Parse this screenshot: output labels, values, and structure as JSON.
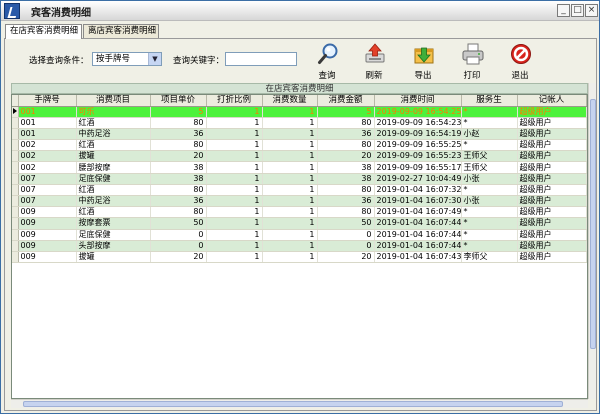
{
  "window": {
    "title": "宾客消费明细",
    "controls": {
      "minimize": "_",
      "maximize": "□",
      "close": "×"
    }
  },
  "tabs": [
    {
      "label": "在店宾客消费明细",
      "active": true
    },
    {
      "label": "离店宾客消费明细",
      "active": false
    }
  ],
  "query": {
    "condition_label": "选择查询条件：",
    "condition_value": "按手牌号",
    "keyword_label": "查询关键字：",
    "keyword_value": ""
  },
  "toolbar": {
    "query": "查询",
    "refresh": "刷新",
    "export": "导出",
    "print": "打印",
    "exit": "退出"
  },
  "grid": {
    "caption": "在店宾客消费明细",
    "columns": [
      "手牌号",
      "消费项目",
      "项目单价",
      "打折比例",
      "消费数量",
      "消费金额",
      "消费时间",
      "服务生",
      "记帐人"
    ],
    "rows": [
      [
        "001",
        "可乐",
        "5",
        "1",
        "1",
        "5",
        "2019-09-09 16:54:25",
        "*",
        "超级用户"
      ],
      [
        "001",
        "红酒",
        "80",
        "1",
        "1",
        "80",
        "2019-09-09 16:54:23",
        "*",
        "超级用户"
      ],
      [
        "001",
        "中药足浴",
        "36",
        "1",
        "1",
        "36",
        "2019-09-09 16:54:19",
        "小赵",
        "超级用户"
      ],
      [
        "002",
        "红酒",
        "80",
        "1",
        "1",
        "80",
        "2019-09-09 16:55:25",
        "*",
        "超级用户"
      ],
      [
        "002",
        "拔罐",
        "20",
        "1",
        "1",
        "20",
        "2019-09-09 16:55:23",
        "王师父",
        "超级用户"
      ],
      [
        "002",
        "腰部按摩",
        "38",
        "1",
        "1",
        "38",
        "2019-09-09 16:55:17",
        "王师父",
        "超级用户"
      ],
      [
        "007",
        "足底保健",
        "38",
        "1",
        "1",
        "38",
        "2019-02-27 10:04:49",
        "小张",
        "超级用户"
      ],
      [
        "007",
        "红酒",
        "80",
        "1",
        "1",
        "80",
        "2019-01-04 16:07:32",
        "*",
        "超级用户"
      ],
      [
        "007",
        "中药足浴",
        "36",
        "1",
        "1",
        "36",
        "2019-01-04 16:07:30",
        "小张",
        "超级用户"
      ],
      [
        "009",
        "红酒",
        "80",
        "1",
        "1",
        "80",
        "2019-01-04 16:07:49",
        "*",
        "超级用户"
      ],
      [
        "009",
        "按摩套票",
        "50",
        "1",
        "1",
        "50",
        "2019-01-04 16:07:44",
        "*",
        "超级用户"
      ],
      [
        "009",
        "足底保健",
        "0",
        "1",
        "1",
        "0",
        "2019-01-04 16:07:44",
        "*",
        "超级用户"
      ],
      [
        "009",
        "头部按摩",
        "0",
        "1",
        "1",
        "0",
        "2019-01-04 16:07:44",
        "*",
        "超级用户"
      ],
      [
        "009",
        "拔罐",
        "20",
        "1",
        "1",
        "20",
        "2019-01-04 16:07:43",
        "李师父",
        "超级用户"
      ]
    ],
    "selected_row": 0
  },
  "icons": {
    "app": "app-logo-icon",
    "query": "magnifier-icon",
    "refresh": "refresh-upload-icon",
    "export": "export-arrow-icon",
    "print": "printer-icon",
    "exit": "no-entry-icon"
  },
  "colors": {
    "selected_row_bg": "#4df23c",
    "selected_row_text": "#ff7a00",
    "alt_row_bg": "#d9ecd6",
    "exit_red": "#d8231c"
  }
}
